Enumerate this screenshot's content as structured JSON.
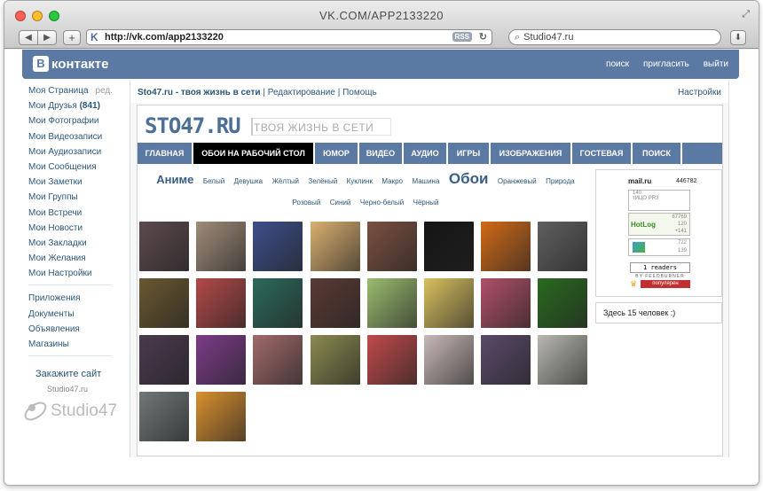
{
  "browser": {
    "window_title": "VK.COM/APP2133220",
    "url": "http://vk.com/app2133220",
    "rss_badge": "RSS",
    "search_value": "Studio47.ru"
  },
  "vk": {
    "logo_letter": "В",
    "logo_text": "контакте",
    "top_links": [
      "поиск",
      "пригласить",
      "выйти"
    ]
  },
  "left_nav": {
    "my_page": "Моя Страница",
    "edit": "ред.",
    "friends": "Мои Друзья",
    "friends_count": "(841)",
    "items_a": [
      "Мои Фотографии",
      "Мои Видеозаписи",
      "Мои Аудиозаписи",
      "Мои Сообщения",
      "Мои Заметки",
      "Мои Группы",
      "Мои Встречи",
      "Мои Новости",
      "Мои Закладки",
      "Мои Желания",
      "Мои Настройки"
    ],
    "items_b": [
      "Приложения",
      "Документы",
      "Объявления",
      "Магазины"
    ],
    "order_site": "Закажите сайт",
    "order_sub": "Studio47.ru",
    "studio_logo": "Studio47"
  },
  "app_bar": {
    "title": "Sto47.ru - твоя жизнь в сети",
    "edit_link": "Редактирование",
    "help_link": "Помощь",
    "settings_link": "Настройки"
  },
  "site": {
    "logo": "STO47.RU",
    "slogan": "ТВОЯ ЖИЗНЬ В СЕТИ",
    "menu": [
      "ГЛАВНАЯ",
      "ОБОИ НА РАБОЧИЙ СТОЛ",
      "ЮМОР",
      "ВИДЕО",
      "АУДИО",
      "ИГРЫ",
      "ИЗОБРАЖЕНИЯ",
      "ГОСТЕВАЯ",
      "ПОИСК"
    ],
    "categories": [
      "Аниме",
      "Белый",
      "Девушка",
      "Жёлтый",
      "Зелёный",
      "Куклинк",
      "Макро",
      "Машина",
      "Обои",
      "Оранжевый",
      "Природа",
      "Розовый",
      "Синий",
      "Черно-белый",
      "Чёрный"
    ],
    "thumb_colors": [
      "#5c4a4e",
      "#a08c7a",
      "#3d4f8a",
      "#d9b070",
      "#7a5040",
      "#151515",
      "#d06a18",
      "#606060",
      "#6a5830",
      "#b44848",
      "#2c6a5a",
      "#5a3a34",
      "#9cbc70",
      "#d8c060",
      "#b05068",
      "#2a6a20",
      "#4a3a4e",
      "#7c3c88",
      "#a06a6a",
      "#8a8a50",
      "#c04a4a",
      "#c8b8b8",
      "#5a4a6a",
      "#b8b8b0",
      "#707878",
      "#d89030"
    ]
  },
  "widgets": {
    "mail_label": "mail.ru",
    "mail_count": "446782",
    "box1_a": "140",
    "box1_b": "тИЦО PR3",
    "hotlog_label": "HotLog",
    "hotlog_a": "87769",
    "hotlog_b": "120",
    "hotlog_c": "+141",
    "li_a": "722",
    "li_b": "139",
    "readers": "1 readers",
    "feedburner": "BY FEEDBURNER",
    "popular": "популярен",
    "online": "Здесь 15 человек  :)"
  }
}
